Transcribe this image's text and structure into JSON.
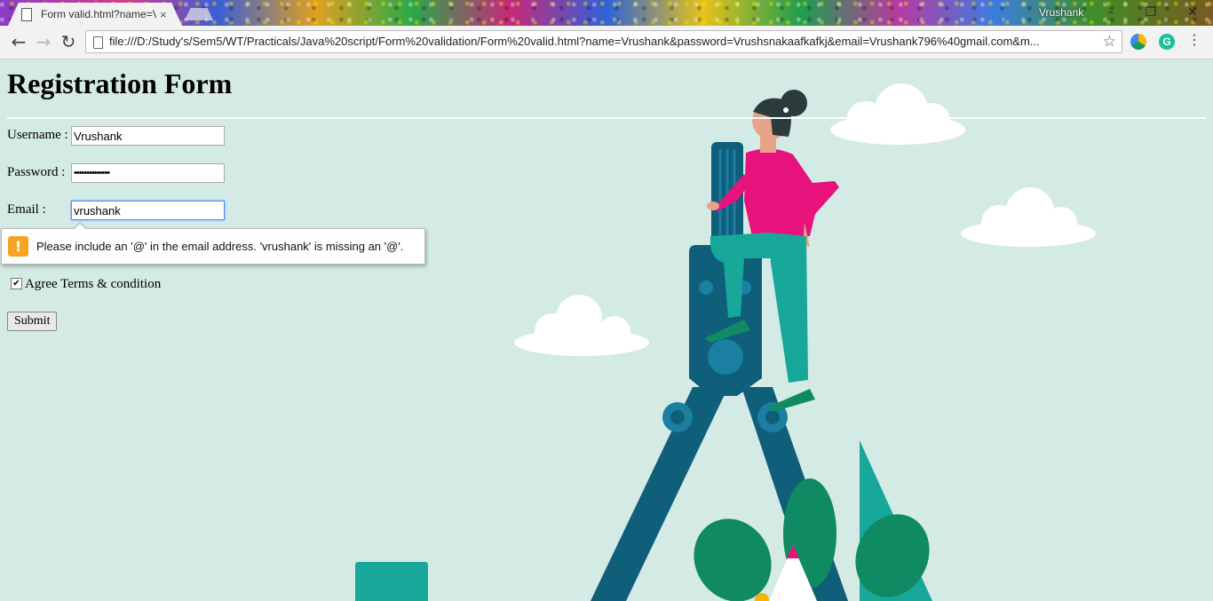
{
  "browser": {
    "tab_title": "Form valid.html?name=V",
    "tab_close": "×",
    "profile_name": "Vrushank",
    "url": "file:///D:/Study's/Sem5/WT/Practicals/Java%20script/Form%20validation/Form%20valid.html?name=Vrushank&password=Vrushsnakaafkafkj&email=Vrushank796%40gmail.com&m...",
    "icons": [
      "page-icon",
      "back-arrow-icon",
      "forward-arrow-icon",
      "reload-icon",
      "star-icon",
      "drive-extension-icon",
      "grammarly-icon",
      "menu-dots-icon",
      "minimize-icon",
      "maximize-icon",
      "close-icon"
    ]
  },
  "form": {
    "heading": "Registration Form",
    "username_label": "Username :",
    "username_value": "Vrushank",
    "password_label": "Password :",
    "password_value": "••••••••••••••",
    "email_label": "Email :",
    "email_value": "vrushank",
    "validation_message": "Please include an '@' in the email address. 'vrushank' is missing an '@'.",
    "agree_checked": true,
    "agree_label": "Agree Terms & condition",
    "submit_label": "Submit"
  },
  "colors": {
    "page_background": "#d4eae5",
    "shirt": "#e8127c",
    "dark_teal": "#0f5e7a",
    "teal": "#17a89a",
    "leaf_green": "#0f8a62",
    "warning": "#f4a322"
  }
}
